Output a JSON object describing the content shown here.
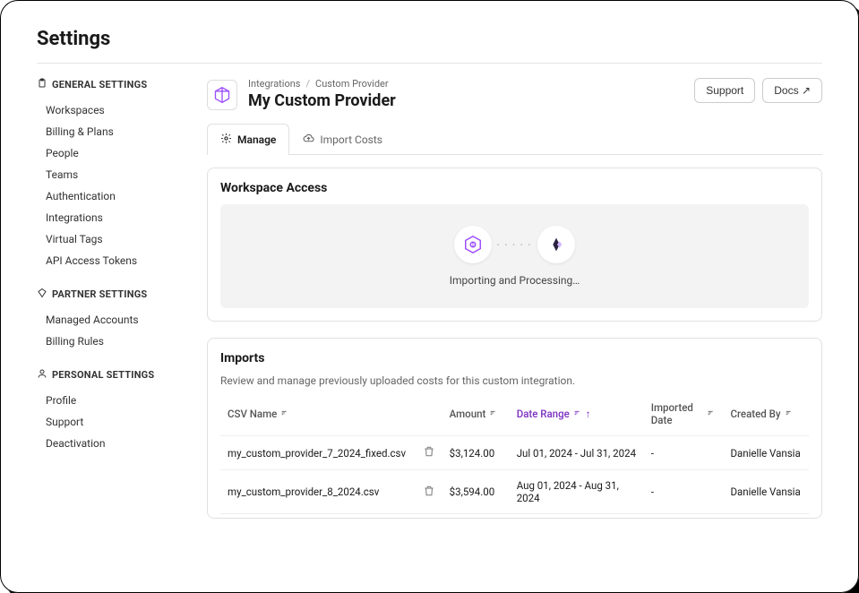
{
  "page_title": "Settings",
  "sidebar": {
    "general": {
      "header": "GENERAL SETTINGS",
      "items": [
        "Workspaces",
        "Billing & Plans",
        "People",
        "Teams",
        "Authentication",
        "Integrations",
        "Virtual Tags",
        "API Access Tokens"
      ]
    },
    "partner": {
      "header": "PARTNER SETTINGS",
      "items": [
        "Managed Accounts",
        "Billing Rules"
      ]
    },
    "personal": {
      "header": "PERSONAL SETTINGS",
      "items": [
        "Profile",
        "Support",
        "Deactivation"
      ]
    }
  },
  "breadcrumb": {
    "root": "Integrations",
    "leaf": "Custom Provider"
  },
  "provider_title": "My Custom Provider",
  "header_buttons": {
    "support": "Support",
    "docs": "Docs ↗"
  },
  "tabs": {
    "manage": "Manage",
    "import": "Import Costs"
  },
  "workspace": {
    "title": "Workspace Access",
    "status": "Importing and Processing…"
  },
  "imports": {
    "title": "Imports",
    "subtitle": "Review and manage previously uploaded costs for this custom integration.",
    "columns": {
      "csv": "CSV Name",
      "amount": "Amount",
      "date": "Date Range",
      "imported": "Imported Date",
      "created": "Created By"
    },
    "rows": [
      {
        "csv": "my_custom_provider_7_2024_fixed.csv",
        "amount": "$3,124.00",
        "date": "Jul 01, 2024 - Jul 31, 2024",
        "imported": "-",
        "created": "Danielle Vansia"
      },
      {
        "csv": "my_custom_provider_8_2024.csv",
        "amount": "$3,594.00",
        "date": "Aug 01, 2024 - Aug 31, 2024",
        "imported": "-",
        "created": "Danielle Vansia"
      }
    ]
  }
}
